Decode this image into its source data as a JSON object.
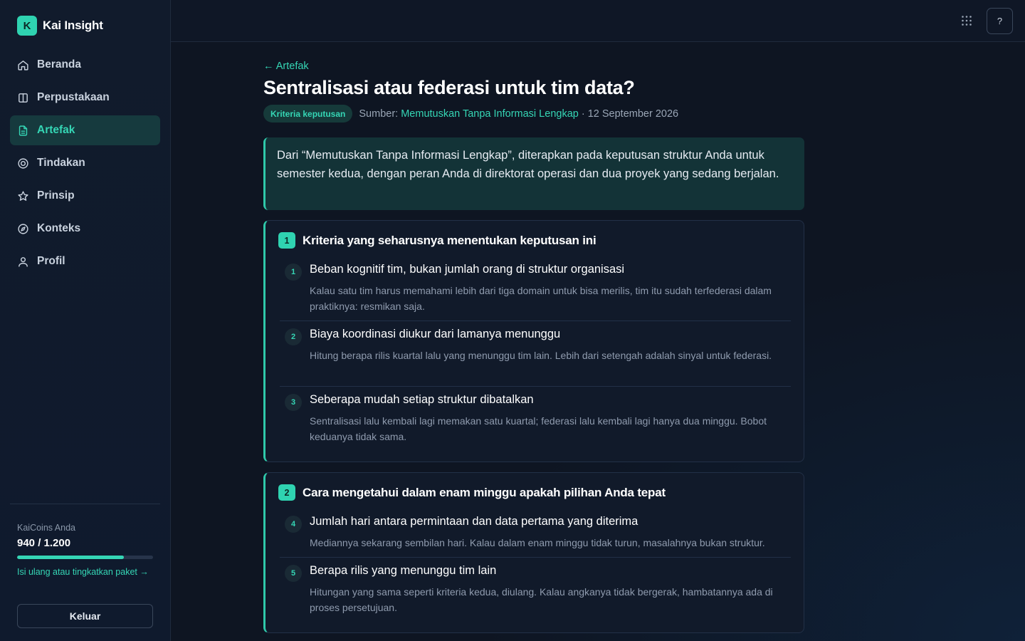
{
  "brand": {
    "logo_letter": "K",
    "name": "Kai Insight"
  },
  "sidebar": {
    "items": [
      {
        "label": "Beranda",
        "icon": "home-icon",
        "active": false
      },
      {
        "label": "Perpustakaan",
        "icon": "book-icon",
        "active": false
      },
      {
        "label": "Artefak",
        "icon": "document-icon",
        "active": true
      },
      {
        "label": "Tindakan",
        "icon": "target-icon",
        "active": false
      },
      {
        "label": "Prinsip",
        "icon": "star-icon",
        "active": false
      },
      {
        "label": "Konteks",
        "icon": "compass-icon",
        "active": false
      },
      {
        "label": "Profil",
        "icon": "user-icon",
        "active": false
      }
    ],
    "coins": {
      "label": "KaiCoins Anda",
      "value": "940 / 1.200",
      "progress": 0.7833,
      "link": "Isi ulang atau tingkatkan paket →"
    },
    "logout_label": "Keluar"
  },
  "topbar": {
    "apps_icon": "grid-icon",
    "help_label": "?"
  },
  "page": {
    "back_link": "← Artefak",
    "title": "Sentralisasi atau federasi untuk tim data?",
    "tag": "Kriteria keputusan",
    "source_prefix": "Sumber:",
    "source_link": "Memutuskan Tanpa Informasi Lengkap",
    "date": "· 12 September 2026",
    "intro": "Dari “Memutuskan Tanpa Informasi Lengkap”, diterapkan pada keputusan struktur Anda untuk semester kedua, dengan peran Anda di direktorat operasi dan dua proyek yang sedang berjalan."
  },
  "sections": [
    {
      "number": "1",
      "title": "Kriteria yang seharusnya menentukan keputusan ini",
      "items": [
        {
          "number": "1",
          "title": "Beban kognitif tim, bukan jumlah orang di struktur organisasi",
          "desc": "Kalau satu tim harus memahami lebih dari tiga domain untuk bisa merilis, tim itu sudah terfederasi dalam praktiknya: resmikan saja."
        },
        {
          "number": "2",
          "title": "Biaya koordinasi diukur dari lamanya menunggu",
          "desc": "Hitung berapa rilis kuartal lalu yang menunggu tim lain. Lebih dari setengah adalah sinyal untuk federasi."
        },
        {
          "number": "3",
          "title": "Seberapa mudah setiap struktur dibatalkan",
          "desc": "Sentralisasi lalu kembali lagi memakan satu kuartal; federasi lalu kembali lagi hanya dua minggu. Bobot keduanya tidak sama."
        }
      ]
    },
    {
      "number": "2",
      "title": "Cara mengetahui dalam enam minggu apakah pilihan Anda tepat",
      "items": [
        {
          "number": "4",
          "title": "Jumlah hari antara permintaan dan data pertama yang diterima",
          "desc": "Mediannya sekarang sembilan hari. Kalau dalam enam minggu tidak turun, masalahnya bukan struktur."
        },
        {
          "number": "5",
          "title": "Berapa rilis yang menunggu tim lain",
          "desc": "Hitungan yang sama seperti kriteria kedua, diulang. Kalau angkanya tidak bergerak, hambatannya ada di proses persetujuan."
        }
      ]
    }
  ],
  "colors": {
    "accent": "#35d6b5",
    "background": "#0e1522",
    "sidebar": "#111b2c"
  }
}
